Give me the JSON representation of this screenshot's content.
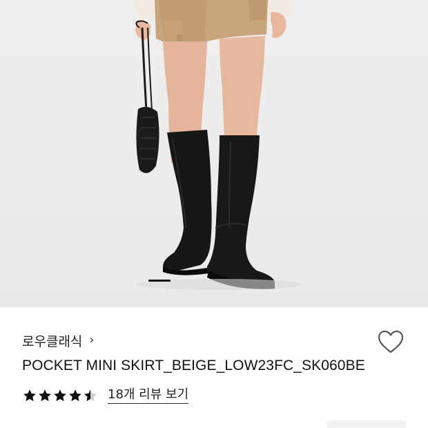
{
  "product_image": {
    "alt": "",
    "carousel_active_index": 1
  },
  "brand": {
    "name": "로우클래식",
    "chevron": "›"
  },
  "wishlist": {
    "icon": "heart-outline-icon"
  },
  "product": {
    "name": "POCKET MINI SKIRT_BEIGE_LOW23FC_SK060BE"
  },
  "rating": {
    "stars": 4.5,
    "max": 5,
    "review_link": "18개 리뷰 보기"
  },
  "colors": {
    "star": "#111111",
    "star_empty": "#cccccc",
    "text": "#111111"
  }
}
